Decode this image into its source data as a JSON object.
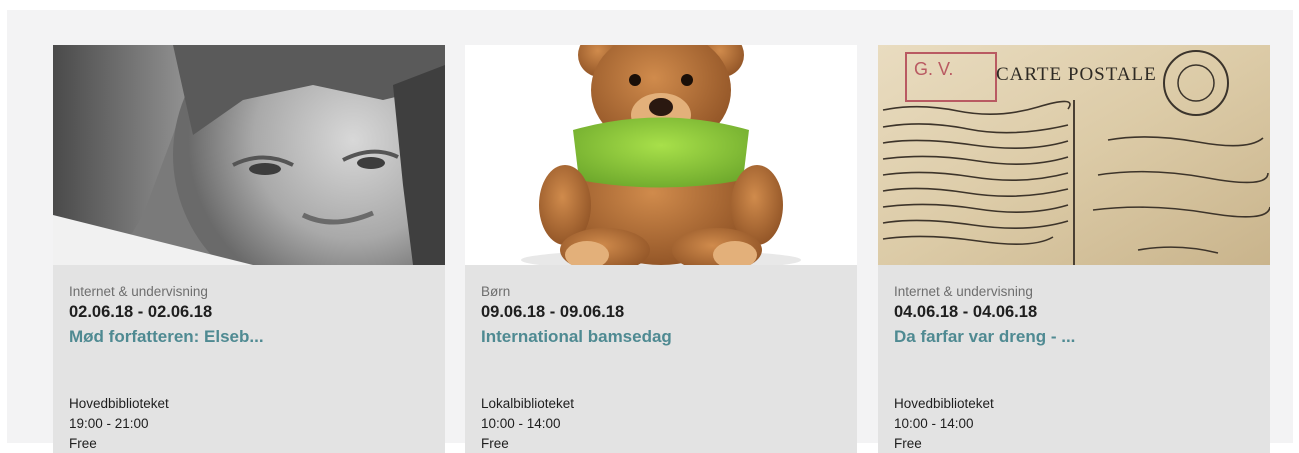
{
  "events": [
    {
      "image": "portrait-photo",
      "category": "Internet & undervisning",
      "dates": "02.06.18 - 02.06.18",
      "title": "Mød forfatteren: Elseb...",
      "location": "Hovedbiblioteket",
      "time": "19:00 - 21:00",
      "price": "Free"
    },
    {
      "image": "teddy-bear-photo",
      "category": "Børn",
      "dates": "09.06.18 - 09.06.18",
      "title": "International bamsedag",
      "location": "Lokalbiblioteket",
      "time": "10:00 - 14:00",
      "price": "Free"
    },
    {
      "image": "postcard-photo",
      "category": "Internet & undervisning",
      "dates": "04.06.18 - 04.06.18",
      "title": "Da farfar var dreng - ...",
      "location": "Hovedbiblioteket",
      "time": "10:00 - 14:00",
      "price": "Free",
      "postcard_text": "CARTE POSTALE",
      "stamp_text": "G. V."
    }
  ],
  "colors": {
    "title": "#4f8a92",
    "card": "#e3e3e3",
    "background": "#f3f3f4"
  }
}
